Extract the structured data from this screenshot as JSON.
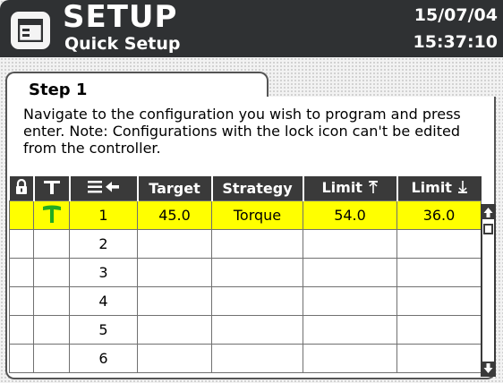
{
  "header": {
    "title": "SETUP",
    "subtitle": "Quick Setup",
    "date": "15/07/04",
    "time": "15:37:10",
    "icon": "window-icon"
  },
  "panel": {
    "step_title": "Step 1",
    "instructions": "Navigate to the configuration you wish to program and press enter. Note: Configurations with the lock icon can't be edited from the controller."
  },
  "table": {
    "columns": [
      {
        "key": "lock",
        "icon": "lock-icon",
        "label": ""
      },
      {
        "key": "tool",
        "icon": "tool-icon",
        "label": ""
      },
      {
        "key": "seq",
        "icon": "list-arrow-icon",
        "label": ""
      },
      {
        "key": "target",
        "label": "Target"
      },
      {
        "key": "strategy",
        "label": "Strategy"
      },
      {
        "key": "limit_high",
        "label": "Limit",
        "icon": "upper-limit-icon"
      },
      {
        "key": "limit_low",
        "label": "Limit",
        "icon": "lower-limit-icon"
      }
    ],
    "rows": [
      {
        "tool_icon": "tool-icon",
        "seq": "1",
        "target": "45.0",
        "strategy": "Torque",
        "limit_high": "54.0",
        "limit_low": "36.0",
        "selected": true
      },
      {
        "seq": "2",
        "target": "",
        "strategy": "",
        "limit_high": "",
        "limit_low": ""
      },
      {
        "seq": "3",
        "target": "",
        "strategy": "",
        "limit_high": "",
        "limit_low": ""
      },
      {
        "seq": "4",
        "target": "",
        "strategy": "",
        "limit_high": "",
        "limit_low": ""
      },
      {
        "seq": "5",
        "target": "",
        "strategy": "",
        "limit_high": "",
        "limit_low": ""
      },
      {
        "seq": "6",
        "target": "",
        "strategy": "",
        "limit_high": "",
        "limit_low": ""
      }
    ]
  },
  "scrollbar": {
    "up_icon": "arrow-up-icon",
    "down_icon": "arrow-down-icon"
  },
  "colors": {
    "header_bg": "#2f3133",
    "selected_row": "#ffff00",
    "tool_icon": "#22aa22",
    "table_header_bg": "#3a3a3a"
  }
}
